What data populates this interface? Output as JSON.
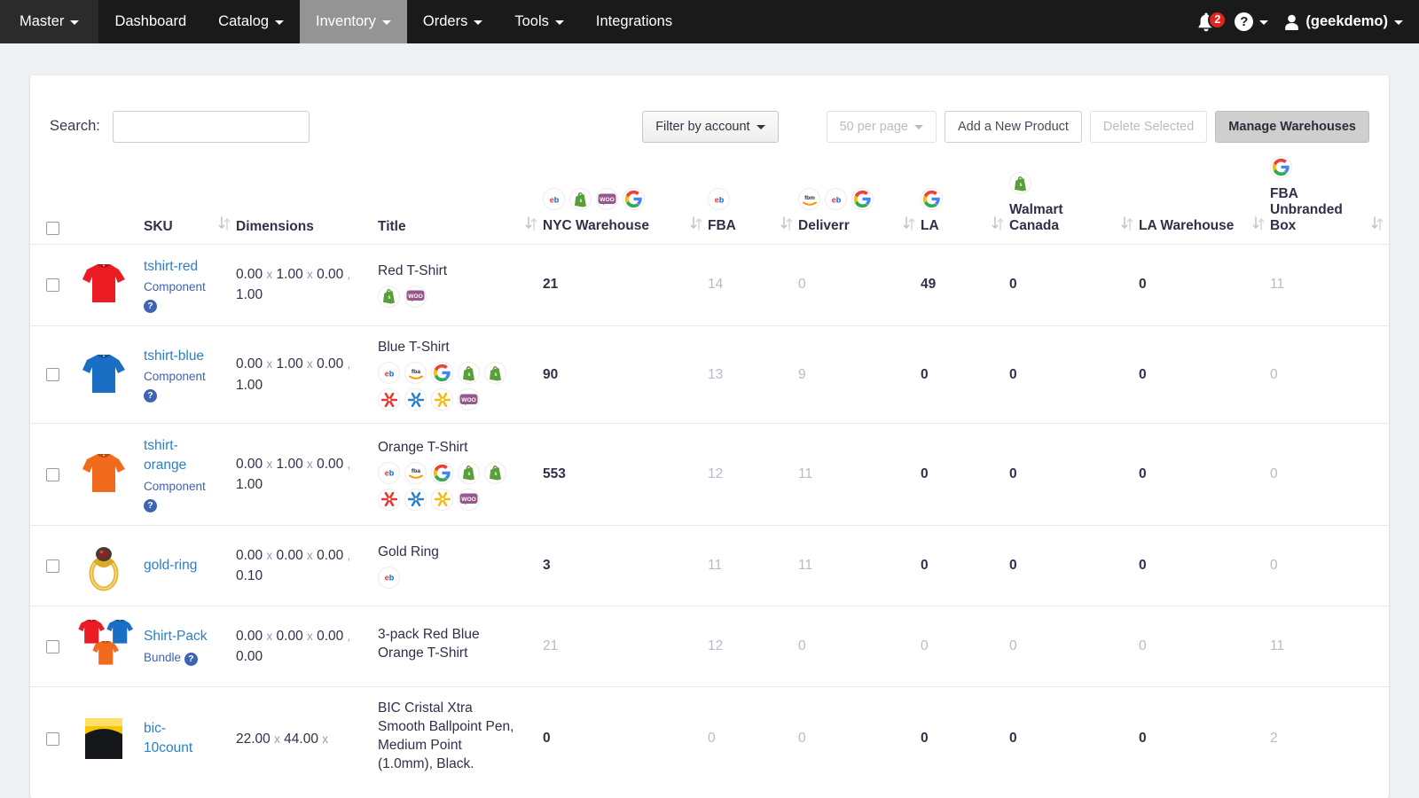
{
  "navbar": {
    "brand": "Master",
    "items": [
      {
        "label": "Dashboard",
        "caret": false,
        "active": false
      },
      {
        "label": "Catalog",
        "caret": true,
        "active": false
      },
      {
        "label": "Inventory",
        "caret": true,
        "active": true
      },
      {
        "label": "Orders",
        "caret": true,
        "active": false
      },
      {
        "label": "Tools",
        "caret": true,
        "active": false
      },
      {
        "label": "Integrations",
        "caret": false,
        "active": false
      }
    ],
    "notification_count": "2",
    "help_label": "?",
    "user": "(geekdemo)"
  },
  "toolbar": {
    "search_label": "Search:",
    "search_value": "",
    "search_placeholder": "",
    "filter_by_account": "Filter by account",
    "per_page": "50 per page",
    "add_product": "Add a New Product",
    "delete_selected": "Delete Selected",
    "manage_warehouses": "Manage Warehouses"
  },
  "table": {
    "headers": {
      "sku": "SKU",
      "dimensions": "Dimensions",
      "title": "Title",
      "nyc_warehouse": "NYC Warehouse",
      "fba": "FBA",
      "deliverr": "Deliverr",
      "la": "LA",
      "walmart_canada": "Walmart Canada",
      "la_warehouse": "LA Warehouse",
      "fba_unbranded_box": "FBA Unbranded Box"
    },
    "header_channels": {
      "nyc_warehouse": [
        "ebay",
        "shopify",
        "woo",
        "google"
      ],
      "fba": [
        "ebay"
      ],
      "deliverr": [
        "fbm",
        "ebay",
        "google"
      ],
      "la": [
        "google"
      ],
      "walmart_canada": [
        "shopify"
      ],
      "la_warehouse": [],
      "fba_unbranded_box": [
        "google"
      ]
    },
    "rows": [
      {
        "thumb": "tshirt-red",
        "sku": "tshirt-red",
        "kind": "Component",
        "dims": "0.00 x 1.00 x 0.00 , 1.00",
        "dim_l": "0.00",
        "dim_w": "1.00",
        "dim_h": "0.00",
        "dim_weight": "1.00",
        "title": "Red T-Shirt",
        "channels": [
          "shopify",
          "woo"
        ],
        "qty": [
          {
            "v": "21",
            "muted": false
          },
          {
            "v": "14",
            "muted": true
          },
          {
            "v": "0",
            "muted": true
          },
          {
            "v": "49",
            "muted": false
          },
          {
            "v": "0",
            "muted": false
          },
          {
            "v": "0",
            "muted": false
          },
          {
            "v": "11",
            "muted": true
          }
        ]
      },
      {
        "thumb": "tshirt-blue",
        "sku": "tshirt-blue",
        "kind": "Component",
        "dims": "0.00 x 1.00 x 0.00 , 1.00",
        "dim_l": "0.00",
        "dim_w": "1.00",
        "dim_h": "0.00",
        "dim_weight": "1.00",
        "title": "Blue T-Shirt",
        "channels": [
          "ebay",
          "fba",
          "google",
          "shopify",
          "shopify",
          "walmart-red",
          "walmart-blue",
          "walmart-yellow",
          "woo"
        ],
        "qty": [
          {
            "v": "90",
            "muted": false
          },
          {
            "v": "13",
            "muted": true
          },
          {
            "v": "9",
            "muted": true
          },
          {
            "v": "0",
            "muted": false
          },
          {
            "v": "0",
            "muted": false
          },
          {
            "v": "0",
            "muted": false
          },
          {
            "v": "0",
            "muted": true
          }
        ]
      },
      {
        "thumb": "tshirt-orange",
        "sku": "tshirt-orange",
        "kind": "Component",
        "dims": "0.00 x 1.00 x 0.00 , 1.00",
        "dim_l": "0.00",
        "dim_w": "1.00",
        "dim_h": "0.00",
        "dim_weight": "1.00",
        "title": "Orange T-Shirt",
        "channels": [
          "ebay",
          "fba",
          "google",
          "shopify",
          "shopify",
          "walmart-red",
          "walmart-blue",
          "walmart-yellow",
          "woo"
        ],
        "qty": [
          {
            "v": "553",
            "muted": false
          },
          {
            "v": "12",
            "muted": true
          },
          {
            "v": "11",
            "muted": true
          },
          {
            "v": "0",
            "muted": false
          },
          {
            "v": "0",
            "muted": false
          },
          {
            "v": "0",
            "muted": false
          },
          {
            "v": "0",
            "muted": true
          }
        ]
      },
      {
        "thumb": "gold-ring",
        "sku": "gold-ring",
        "kind": "",
        "dims": "0.00 x 0.00 x 0.00 , 0.10",
        "dim_l": "0.00",
        "dim_w": "0.00",
        "dim_h": "0.00",
        "dim_weight": "0.10",
        "title": "Gold Ring",
        "channels": [
          "ebay"
        ],
        "qty": [
          {
            "v": "3",
            "muted": false
          },
          {
            "v": "11",
            "muted": true
          },
          {
            "v": "11",
            "muted": true
          },
          {
            "v": "0",
            "muted": false
          },
          {
            "v": "0",
            "muted": false
          },
          {
            "v": "0",
            "muted": false
          },
          {
            "v": "0",
            "muted": true
          }
        ]
      },
      {
        "thumb": "shirt-pack",
        "sku": "Shirt-Pack",
        "kind": "Bundle",
        "dims": "0.00 x 0.00 x 0.00 , 0.00",
        "dim_l": "0.00",
        "dim_w": "0.00",
        "dim_h": "0.00",
        "dim_weight": "0.00",
        "title": "3-pack Red Blue Orange T-Shirt",
        "channels": [],
        "qty": [
          {
            "v": "21",
            "muted": true
          },
          {
            "v": "12",
            "muted": true
          },
          {
            "v": "0",
            "muted": true
          },
          {
            "v": "0",
            "muted": true
          },
          {
            "v": "0",
            "muted": true
          },
          {
            "v": "0",
            "muted": true
          },
          {
            "v": "11",
            "muted": true
          }
        ]
      },
      {
        "thumb": "bic-pen",
        "sku": "bic-10count",
        "kind": "",
        "dims": "22.00 x 44.00 x",
        "dim_l": "22.00",
        "dim_w": "44.00",
        "dim_h": "",
        "dim_weight": "",
        "title": "BIC Cristal Xtra Smooth Ballpoint Pen, Medium Point (1.0mm), Black.",
        "channels": [],
        "qty": [
          {
            "v": "0",
            "muted": false
          },
          {
            "v": "0",
            "muted": true
          },
          {
            "v": "0",
            "muted": true
          },
          {
            "v": "0",
            "muted": false
          },
          {
            "v": "0",
            "muted": false
          },
          {
            "v": "0",
            "muted": false
          },
          {
            "v": "2",
            "muted": true
          }
        ]
      }
    ]
  },
  "colors": {
    "navbar_bg": "#1a1a1a",
    "link": "#2a7fc9",
    "badge": "#e0261c",
    "text": "#2f3049",
    "muted": "#b9bac8"
  }
}
